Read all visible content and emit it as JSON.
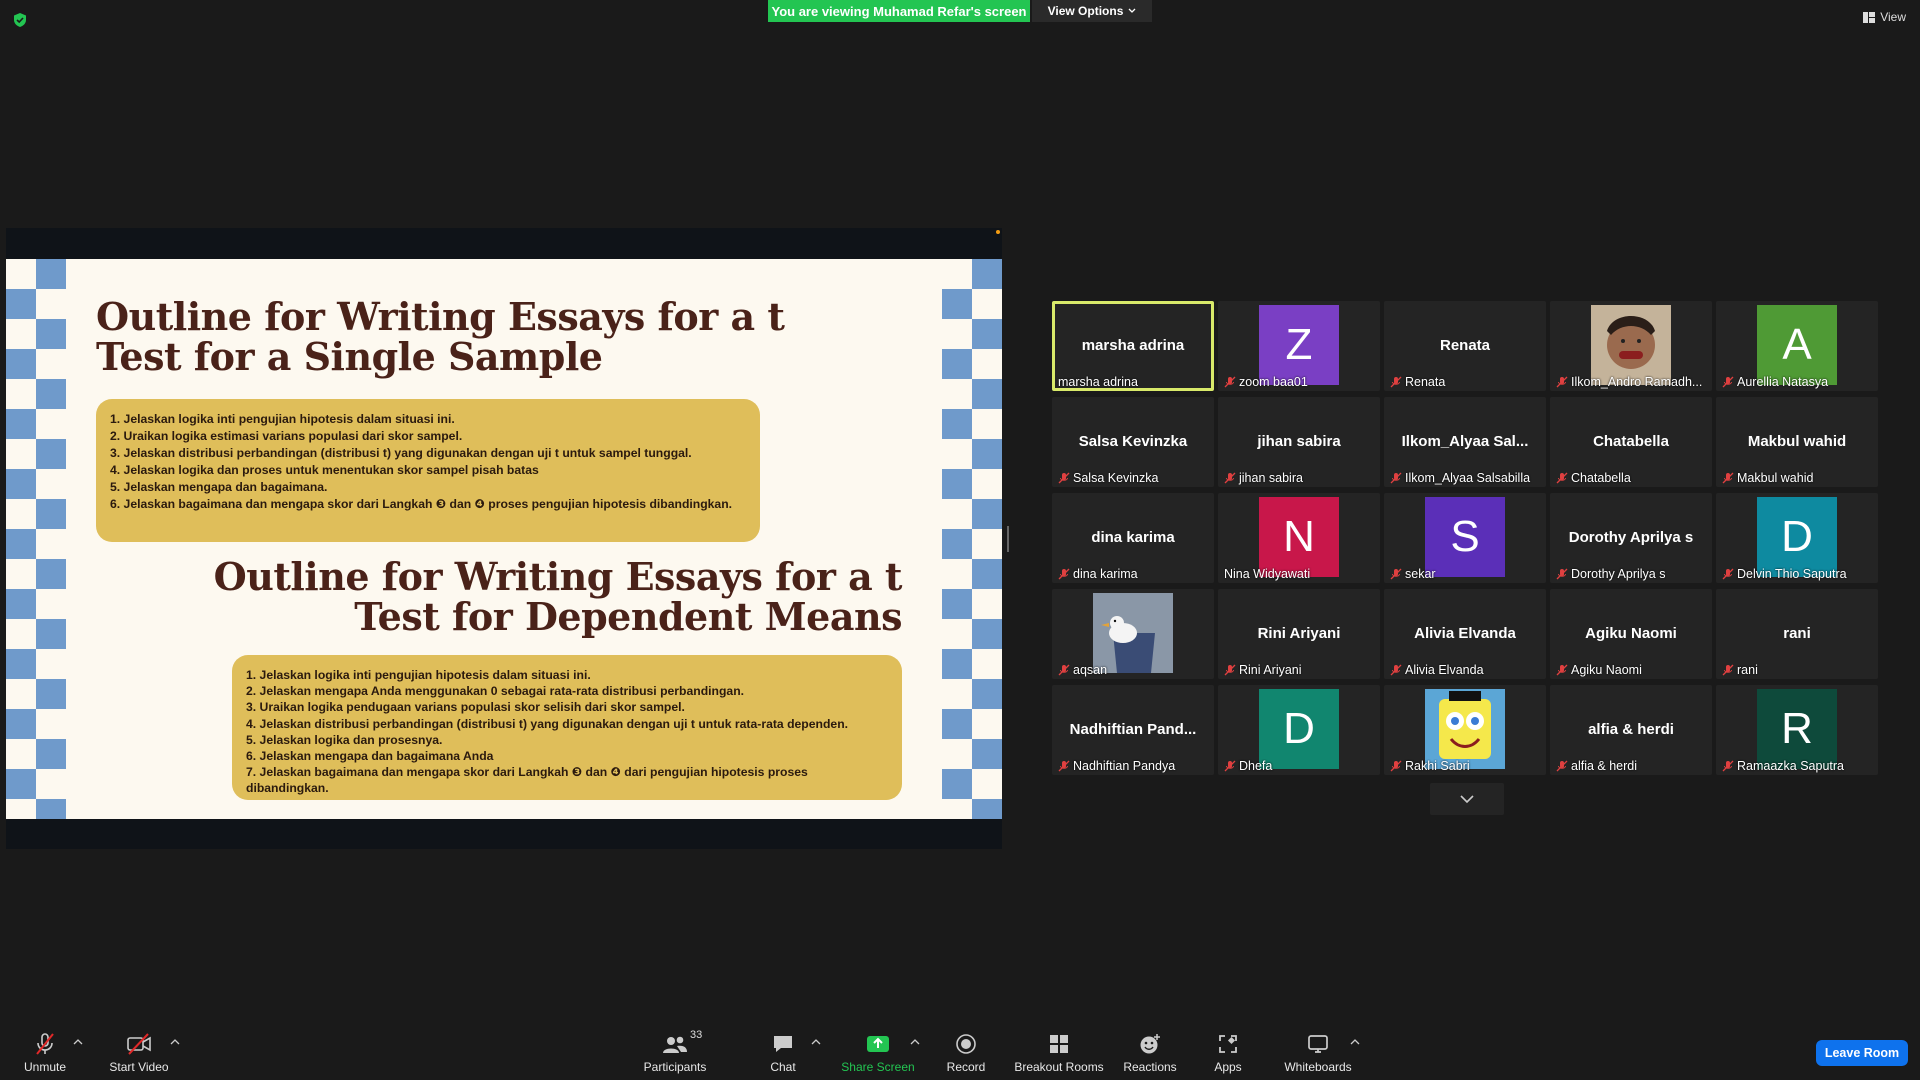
{
  "top_bar": {
    "viewing_banner": "You are viewing Muhamad Refar's screen",
    "view_options": "View Options",
    "view_label": "View"
  },
  "slide": {
    "title1_line1": "Outline for Writing Essays for a t",
    "title1_line2": "Test for a Single Sample",
    "box1_items": [
      "1. Jelaskan logika inti pengujian hipotesis dalam situasi ini.",
      "2. Uraikan logika estimasi varians populasi dari skor sampel.",
      "3. Jelaskan distribusi perbandingan (distribusi t) yang digunakan dengan uji t untuk sampel tunggal.",
      "4. Jelaskan logika dan proses untuk menentukan skor sampel pisah batas",
      "5. Jelaskan mengapa dan bagaimana.",
      "6. Jelaskan bagaimana dan mengapa skor dari Langkah ❸ dan ❹ proses pengujian hipotesis dibandingkan."
    ],
    "title2_line1": "Outline for Writing Essays for a t",
    "title2_line2": "Test for Dependent Means",
    "box2_items": [
      "1. Jelaskan logika inti pengujian hipotesis dalam situasi ini.",
      "2. Jelaskan mengapa Anda menggunakan 0 sebagai rata-rata distribusi perbandingan.",
      "3. Uraikan logika pendugaan varians populasi skor selisih dari skor sampel.",
      "4. Jelaskan distribusi perbandingan (distribusi t) yang digunakan dengan uji t untuk rata-rata dependen.",
      "5. Jelaskan logika dan prosesnya.",
      "6. Jelaskan mengapa dan bagaimana Anda",
      "7. Jelaskan bagaimana dan mengapa skor dari Langkah ❸ dan ❹ dari pengujian hipotesis proses dibandingkan."
    ]
  },
  "colors": {
    "accent_green": "#23c552",
    "active_speaker": "#d9ea6a",
    "leave_blue": "#0e72ed"
  },
  "participants": [
    {
      "big": "marsha adrina",
      "label": "marsha adrina",
      "muted": false,
      "active": true
    },
    {
      "avatar": "Z",
      "color": "#7a3fc4",
      "label": "zoom baa01",
      "muted": true
    },
    {
      "big": "Renata",
      "label": "Renata",
      "muted": true
    },
    {
      "photo": "person-photo",
      "label": "Ilkom_Andro Ramadh...",
      "muted": true
    },
    {
      "avatar": "A",
      "color": "#4f9a35",
      "label": "Aurellia Natasya",
      "muted": true
    },
    {
      "big": "Salsa Kevinzka",
      "label": "Salsa Kevinzka",
      "muted": true
    },
    {
      "big": "jihan sabira",
      "label": "jihan sabira",
      "muted": true
    },
    {
      "big": "Ilkom_Alyaa  Sal...",
      "label": "Ilkom_Alyaa Salsabilla",
      "muted": true
    },
    {
      "big": "Chatabella",
      "label": "Chatabella",
      "muted": true
    },
    {
      "big": "Makbul wahid",
      "label": "Makbul wahid",
      "muted": true
    },
    {
      "big": "dina karima",
      "label": "dina karima",
      "muted": true
    },
    {
      "avatar": "N",
      "color": "#c8174a",
      "label": "Nina Widyawati",
      "muted": false
    },
    {
      "avatar": "S",
      "color": "#5b2fb8",
      "label": "sekar",
      "muted": true
    },
    {
      "big": "Dorothy Aprilya s",
      "label": "Dorothy Aprilya s",
      "muted": true
    },
    {
      "avatar": "D",
      "color": "#0e8aa0",
      "label": "Delvin Thio Saputra",
      "muted": true
    },
    {
      "photo": "duck-photo",
      "label": "aqsan",
      "muted": true
    },
    {
      "big": "Rini Ariyani",
      "label": "Rini Ariyani",
      "muted": true
    },
    {
      "big": "Alivia Elvanda",
      "label": "Alivia Elvanda",
      "muted": true
    },
    {
      "big": "Agiku Naomi",
      "label": "Agiku Naomi",
      "muted": true
    },
    {
      "big": "rani",
      "label": "rani",
      "muted": true
    },
    {
      "big": "Nadhiftian  Pand...",
      "label": "Nadhiftian Pandya",
      "muted": true
    },
    {
      "avatar": "D",
      "color": "#11866f",
      "label": "Dhefa",
      "muted": true
    },
    {
      "photo": "cartoon-photo",
      "label": "Rakhi Sabri",
      "muted": true
    },
    {
      "big": "alfia & herdi",
      "label": "alfia & herdi",
      "muted": true
    },
    {
      "avatar": "R",
      "color": "#0e4a3b",
      "label": "Ramaazka Saputra",
      "muted": true
    }
  ],
  "toolbar": {
    "unmute": "Unmute",
    "start_video": "Start Video",
    "participants": "Participants",
    "participants_count": "33",
    "chat": "Chat",
    "share_screen": "Share Screen",
    "record": "Record",
    "breakout_rooms": "Breakout Rooms",
    "reactions": "Reactions",
    "apps": "Apps",
    "whiteboards": "Whiteboards",
    "leave_room": "Leave Room"
  }
}
